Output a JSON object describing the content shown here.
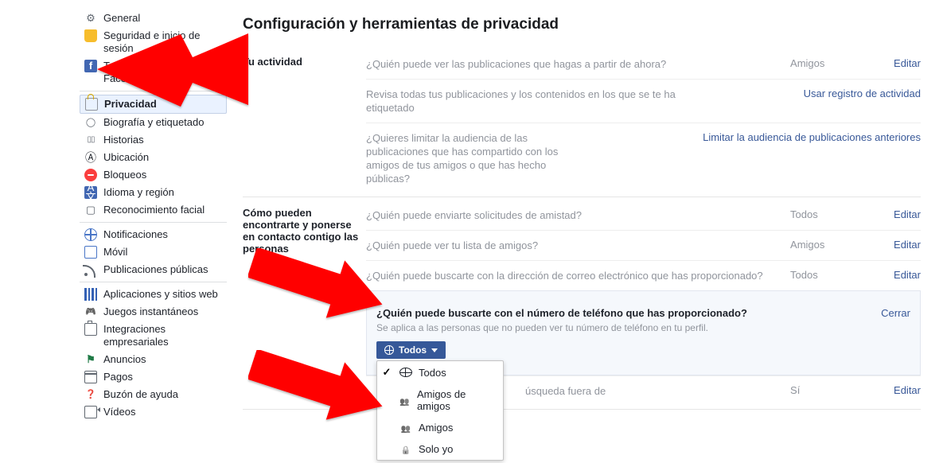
{
  "page_title": "Configuración y herramientas de privacidad",
  "sidebar": {
    "groups": [
      {
        "items": [
          {
            "icon": "gear-icon",
            "label": "General"
          },
          {
            "icon": "shield-icon",
            "label": "Seguridad e inicio de sesión"
          },
          {
            "icon": "fb-icon",
            "label": "Tu información de Facebook"
          }
        ]
      },
      {
        "items": [
          {
            "icon": "lock-box",
            "label": "Privacidad",
            "selected": true
          },
          {
            "icon": "tag-icon",
            "label": "Biografía y etiquetado"
          },
          {
            "icon": "book-icon",
            "label": "Historias"
          },
          {
            "icon": "pin-icon",
            "label": "Ubicación"
          },
          {
            "icon": "minus-icon",
            "label": "Bloqueos"
          },
          {
            "icon": "lang-icon",
            "label": "Idioma y región"
          },
          {
            "icon": "face-icon",
            "label": "Reconocimiento facial"
          }
        ]
      },
      {
        "items": [
          {
            "icon": "globe-blue",
            "label": "Notificaciones"
          },
          {
            "icon": "mobile-icon",
            "label": "Móvil"
          },
          {
            "icon": "rss-icon",
            "label": "Publicaciones públicas"
          }
        ]
      },
      {
        "items": [
          {
            "icon": "apps-icon",
            "label": "Aplicaciones y sitios web"
          },
          {
            "icon": "games-icon",
            "label": "Juegos instantáneos"
          },
          {
            "icon": "briefcase-icon",
            "label": "Integraciones empresariales"
          },
          {
            "icon": "ads-icon",
            "label": "Anuncios"
          },
          {
            "icon": "payments-icon",
            "label": "Pagos"
          },
          {
            "icon": "help-icon",
            "label": "Buzón de ayuda"
          },
          {
            "icon": "video-icon",
            "label": "Vídeos"
          }
        ]
      }
    ]
  },
  "sections": [
    {
      "label": "Tu actividad",
      "rows": [
        {
          "q": "¿Quién puede ver las publicaciones que hagas a partir de ahora?",
          "status": "Amigos",
          "action": "Editar"
        },
        {
          "q": "Revisa todas tus publicaciones y los contenidos en los que se te ha etiquetado",
          "status": "",
          "action": "Usar registro de actividad"
        },
        {
          "q": "¿Quieres limitar la audiencia de las publicaciones que has compartido con los amigos de tus amigos o que has hecho públicas?",
          "status": "",
          "action": "Limitar la audiencia de publicaciones anteriores"
        }
      ]
    },
    {
      "label": "Cómo pueden encontrarte y ponerse en contacto contigo las personas",
      "rows": [
        {
          "q": "¿Quién puede enviarte solicitudes de amistad?",
          "status": "Todos",
          "action": "Editar"
        },
        {
          "q": "¿Quién puede ver tu lista de amigos?",
          "status": "Amigos",
          "action": "Editar"
        },
        {
          "q": "¿Quién puede buscarte con la dirección de correo electrónico que has proporcionado?",
          "status": "Todos",
          "action": "Editar"
        }
      ],
      "expanded": {
        "title": "¿Quién puede buscarte con el número de teléfono que has proporcionado?",
        "sub": "Se aplica a las personas que no pueden ver tu número de teléfono en tu perfil.",
        "close": "Cerrar",
        "button": "Todos",
        "options": [
          {
            "icon": "globe-sm",
            "label": "Todos",
            "checked": true
          },
          {
            "icon": "friends-friends",
            "label": "Amigos de amigos"
          },
          {
            "icon": "friends-icon",
            "label": "Amigos"
          },
          {
            "icon": "lock-sm",
            "label": "Solo yo"
          }
        ]
      },
      "after": [
        {
          "q_fragment": "úsqueda fuera de",
          "status": "Sí",
          "action": "Editar"
        }
      ]
    }
  ]
}
